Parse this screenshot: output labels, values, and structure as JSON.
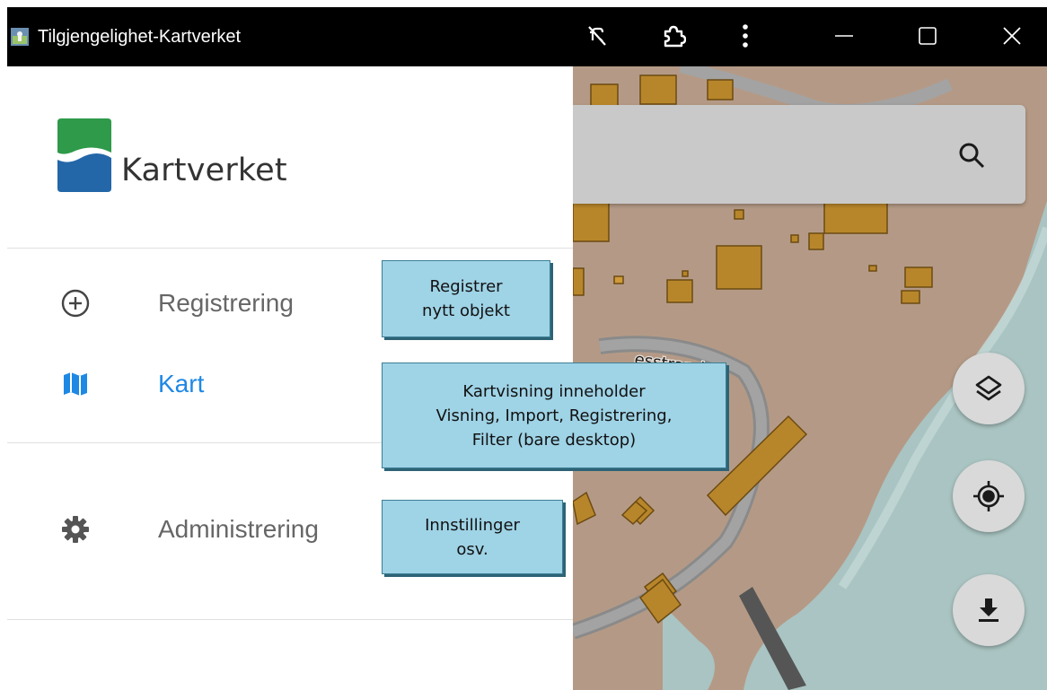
{
  "window": {
    "title": "Tilgjengelighet-Kartverket",
    "app_icon": "app-icon",
    "toolbar_icons": [
      "tracking-prevention-icon",
      "extensions-icon",
      "more-options-icon"
    ],
    "controls": [
      "minimize-icon",
      "maximize-icon",
      "close-icon"
    ]
  },
  "drawer": {
    "brand": "Kartverket",
    "nav": [
      {
        "label": "Registrering",
        "icon": "add-circle-icon",
        "active": false
      },
      {
        "label": "Kart",
        "icon": "map-icon",
        "active": true
      },
      {
        "label": "Administrering",
        "icon": "gear-icon",
        "active": false
      }
    ]
  },
  "map": {
    "street_label": "esstranda",
    "search_icon": "search-icon",
    "fabs": [
      "layers-icon",
      "my-location-icon",
      "download-icon"
    ]
  },
  "callouts": [
    {
      "text": "Registrer\nnytt objekt"
    },
    {
      "text": "Kartvisning inneholder\nVisning, Import, Registrering,\nFilter (bare desktop)"
    },
    {
      "text": "Innstillinger\nosv."
    }
  ],
  "colors": {
    "active": "#1e88e5",
    "callout_bg": "#9fd3e6",
    "water": "#a9c4c2",
    "land": "#b49a86",
    "building": "#b8862a"
  }
}
